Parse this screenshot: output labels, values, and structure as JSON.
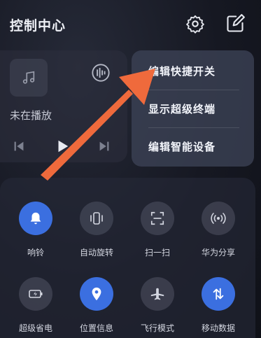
{
  "header": {
    "title": "控制中心",
    "settings_icon": "gear-icon",
    "edit_icon": "edit-icon"
  },
  "media": {
    "status": "未在播放",
    "icons": [
      "music-note-icon",
      "cast-icon",
      "previous-icon",
      "play-icon",
      "next-icon"
    ]
  },
  "popup_menu": {
    "items": [
      {
        "label": "编辑快捷开关"
      },
      {
        "label": "显示超级终端"
      },
      {
        "label": "编辑智能设备"
      }
    ]
  },
  "tiles": [
    {
      "label": "响铃",
      "icon": "bell-icon",
      "active": true
    },
    {
      "label": "自动旋转",
      "icon": "rotate-icon",
      "active": false
    },
    {
      "label": "扫一扫",
      "icon": "scan-icon",
      "active": false
    },
    {
      "label": "华为分享",
      "icon": "share-waves-icon",
      "active": false
    },
    {
      "label": "超级省电",
      "icon": "battery-saver-icon",
      "active": false
    },
    {
      "label": "位置信息",
      "icon": "location-icon",
      "active": true
    },
    {
      "label": "飞行模式",
      "icon": "airplane-icon",
      "active": false
    },
    {
      "label": "移动数据",
      "icon": "mobile-data-icon",
      "active": true
    }
  ],
  "colors": {
    "accent": "#3b6fe0",
    "annotation_arrow": "#ef6a3c"
  }
}
